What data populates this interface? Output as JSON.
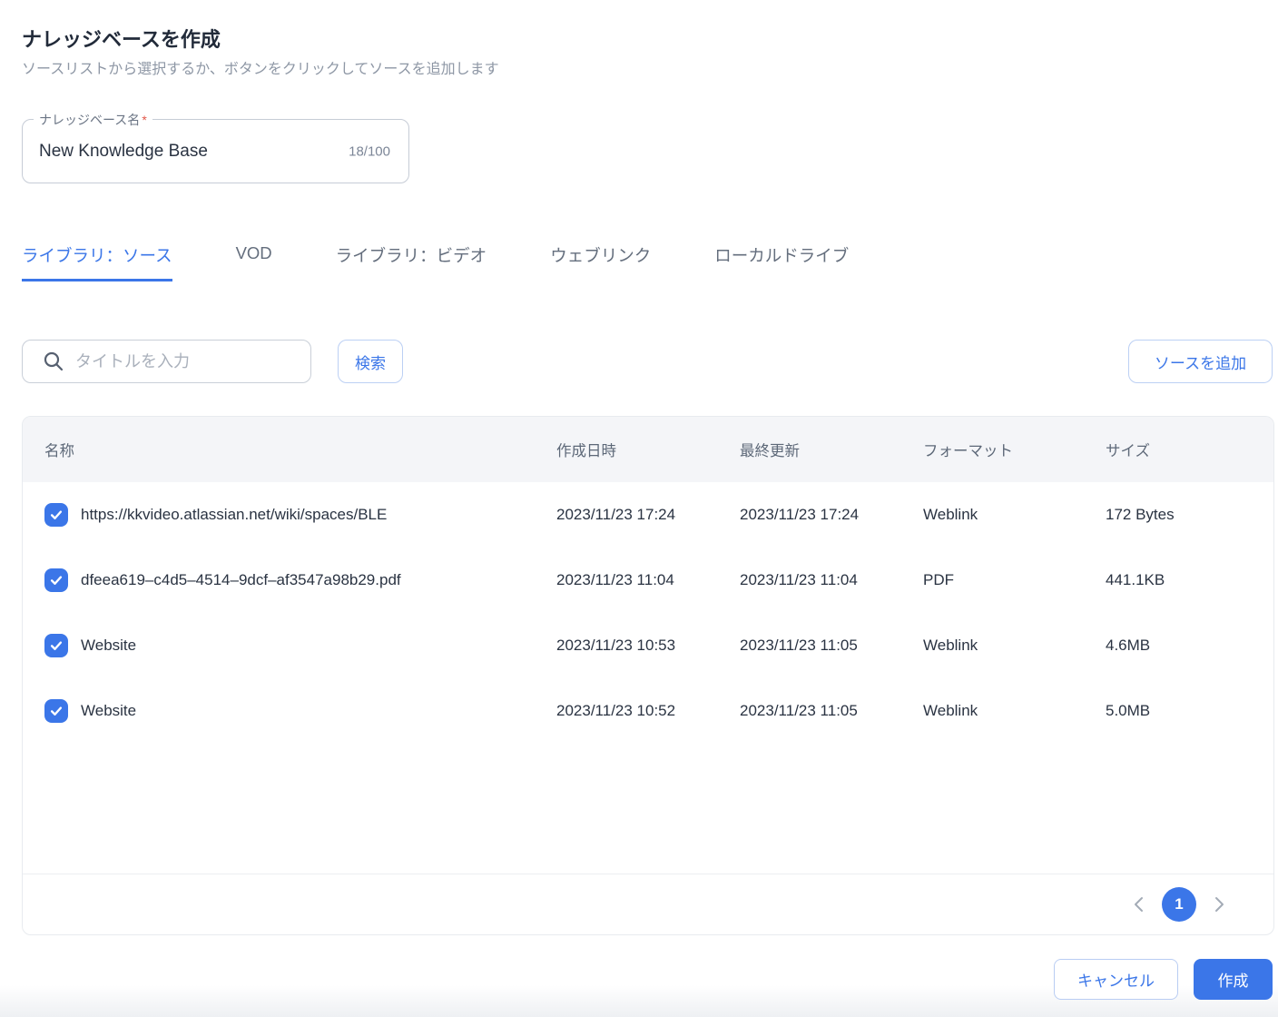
{
  "page": {
    "title": "ナレッジベースを作成",
    "subtitle": "ソースリストから選択するか、ボタンをクリックしてソースを追加します"
  },
  "name_field": {
    "label": "ナレッジベース名",
    "required_mark": "*",
    "value": "New Knowledge Base",
    "counter": "18/100"
  },
  "tabs": [
    {
      "label": "ライブラリ：ソース",
      "active": true
    },
    {
      "label": "VOD",
      "active": false
    },
    {
      "label": "ライブラリ：ビデオ",
      "active": false
    },
    {
      "label": "ウェブリンク",
      "active": false
    },
    {
      "label": "ローカルドライブ",
      "active": false
    }
  ],
  "toolbar": {
    "search_placeholder": "タイトルを入力",
    "search_button": "検索",
    "add_source_button": "ソースを追加"
  },
  "table": {
    "columns": [
      "名称",
      "作成日時",
      "最終更新",
      "フォーマット",
      "サイズ"
    ],
    "rows": [
      {
        "checked": true,
        "name": "https://kkvideo.atlassian.net/wiki/spaces/BLE",
        "created": "2023/11/23 17:24",
        "updated": "2023/11/23 17:24",
        "format": "Weblink",
        "size": "172 Bytes"
      },
      {
        "checked": true,
        "name": "dfeea619–c4d5–4514–9dcf–af3547a98b29.pdf",
        "created": "2023/11/23 11:04",
        "updated": "2023/11/23 11:04",
        "format": "PDF",
        "size": "441.1KB"
      },
      {
        "checked": true,
        "name": "Website",
        "created": "2023/11/23 10:53",
        "updated": "2023/11/23 11:05",
        "format": "Weblink",
        "size": "4.6MB"
      },
      {
        "checked": true,
        "name": "Website",
        "created": "2023/11/23 10:52",
        "updated": "2023/11/23 11:05",
        "format": "Weblink",
        "size": "5.0MB"
      }
    ]
  },
  "pagination": {
    "current_page": "1"
  },
  "actions": {
    "cancel": "キャンセル",
    "create": "作成"
  },
  "colors": {
    "accent": "#3b76e8",
    "accent_border": "#bcd0f4",
    "required": "#e2574a",
    "header_bg": "#f4f5f8",
    "text": "#2a3342",
    "muted_text": "#8e97a5"
  }
}
